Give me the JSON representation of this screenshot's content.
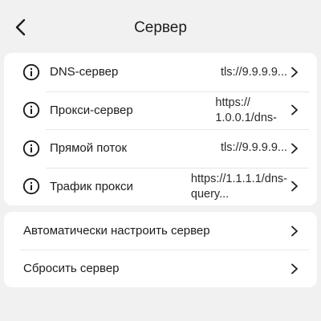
{
  "header": {
    "back_icon": "chevron-left-icon",
    "title": "Сервер"
  },
  "servers": {
    "items": [
      {
        "label": "DNS-сервер",
        "value": "tls://9.9.9.9...",
        "icon": "info-icon"
      },
      {
        "label": "Прокси-сервер",
        "value": "https://\n1.0.0.1/dns-",
        "icon": "info-icon"
      },
      {
        "label": "Прямой поток",
        "value": "tls://9.9.9.9...",
        "icon": "info-icon"
      },
      {
        "label": "Трафик прокси",
        "value": "https://1.1.1.1/dns-\nquery...",
        "icon": "info-icon"
      }
    ]
  },
  "actions": {
    "items": [
      {
        "label": "Автоматически настроить сервер"
      },
      {
        "label": "Сбросить сервер"
      }
    ]
  },
  "colors": {
    "background": "#f1f1f1",
    "card": "#ffffff",
    "text": "#1c1c1c"
  }
}
